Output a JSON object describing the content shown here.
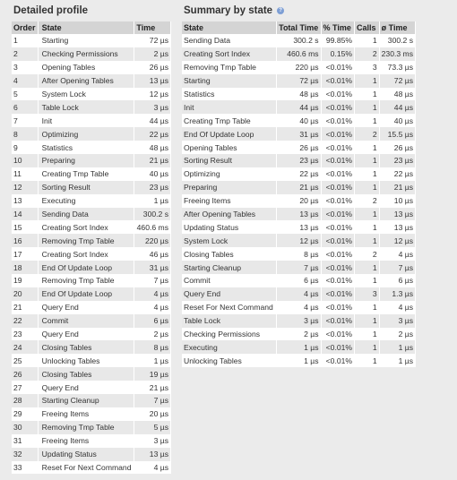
{
  "detailed": {
    "title": "Detailed profile",
    "headers": {
      "order": "Order",
      "state": "State",
      "time": "Time"
    },
    "rows": [
      {
        "order": "1",
        "state": "Starting",
        "time": "72 µs"
      },
      {
        "order": "2",
        "state": "Checking Permissions",
        "time": "2 µs"
      },
      {
        "order": "3",
        "state": "Opening Tables",
        "time": "26 µs"
      },
      {
        "order": "4",
        "state": "After Opening Tables",
        "time": "13 µs"
      },
      {
        "order": "5",
        "state": "System Lock",
        "time": "12 µs"
      },
      {
        "order": "6",
        "state": "Table Lock",
        "time": "3 µs"
      },
      {
        "order": "7",
        "state": "Init",
        "time": "44 µs"
      },
      {
        "order": "8",
        "state": "Optimizing",
        "time": "22 µs"
      },
      {
        "order": "9",
        "state": "Statistics",
        "time": "48 µs"
      },
      {
        "order": "10",
        "state": "Preparing",
        "time": "21 µs"
      },
      {
        "order": "11",
        "state": "Creating Tmp Table",
        "time": "40 µs"
      },
      {
        "order": "12",
        "state": "Sorting Result",
        "time": "23 µs"
      },
      {
        "order": "13",
        "state": "Executing",
        "time": "1 µs"
      },
      {
        "order": "14",
        "state": "Sending Data",
        "time": "300.2 s"
      },
      {
        "order": "15",
        "state": "Creating Sort Index",
        "time": "460.6 ms"
      },
      {
        "order": "16",
        "state": "Removing Tmp Table",
        "time": "220 µs"
      },
      {
        "order": "17",
        "state": "Creating Sort Index",
        "time": "46 µs"
      },
      {
        "order": "18",
        "state": "End Of Update Loop",
        "time": "31 µs"
      },
      {
        "order": "19",
        "state": "Removing Tmp Table",
        "time": "7 µs"
      },
      {
        "order": "20",
        "state": "End Of Update Loop",
        "time": "4 µs"
      },
      {
        "order": "21",
        "state": "Query End",
        "time": "4 µs"
      },
      {
        "order": "22",
        "state": "Commit",
        "time": "6 µs"
      },
      {
        "order": "23",
        "state": "Query End",
        "time": "2 µs"
      },
      {
        "order": "24",
        "state": "Closing Tables",
        "time": "8 µs"
      },
      {
        "order": "25",
        "state": "Unlocking Tables",
        "time": "1 µs"
      },
      {
        "order": "26",
        "state": "Closing Tables",
        "time": "19 µs"
      },
      {
        "order": "27",
        "state": "Query End",
        "time": "21 µs"
      },
      {
        "order": "28",
        "state": "Starting Cleanup",
        "time": "7 µs"
      },
      {
        "order": "29",
        "state": "Freeing Items",
        "time": "20 µs"
      },
      {
        "order": "30",
        "state": "Removing Tmp Table",
        "time": "5 µs"
      },
      {
        "order": "31",
        "state": "Freeing Items",
        "time": "3 µs"
      },
      {
        "order": "32",
        "state": "Updating Status",
        "time": "13 µs"
      },
      {
        "order": "33",
        "state": "Reset For Next Command",
        "time": "4 µs"
      }
    ]
  },
  "summary": {
    "title": "Summary by state",
    "help_icon": "help-icon",
    "headers": {
      "state": "State",
      "total": "Total Time",
      "pct": "% Time",
      "calls": "Calls",
      "avg": "ø Time"
    },
    "rows": [
      {
        "state": "Sending Data",
        "total": "300.2 s",
        "pct": "99.85%",
        "calls": "1",
        "avg": "300.2 s"
      },
      {
        "state": "Creating Sort Index",
        "total": "460.6 ms",
        "pct": "0.15%",
        "calls": "2",
        "avg": "230.3 ms"
      },
      {
        "state": "Removing Tmp Table",
        "total": "220 µs",
        "pct": "<0.01%",
        "calls": "3",
        "avg": "73.3 µs"
      },
      {
        "state": "Starting",
        "total": "72 µs",
        "pct": "<0.01%",
        "calls": "1",
        "avg": "72 µs"
      },
      {
        "state": "Statistics",
        "total": "48 µs",
        "pct": "<0.01%",
        "calls": "1",
        "avg": "48 µs"
      },
      {
        "state": "Init",
        "total": "44 µs",
        "pct": "<0.01%",
        "calls": "1",
        "avg": "44 µs"
      },
      {
        "state": "Creating Tmp Table",
        "total": "40 µs",
        "pct": "<0.01%",
        "calls": "1",
        "avg": "40 µs"
      },
      {
        "state": "End Of Update Loop",
        "total": "31 µs",
        "pct": "<0.01%",
        "calls": "2",
        "avg": "15.5 µs"
      },
      {
        "state": "Opening Tables",
        "total": "26 µs",
        "pct": "<0.01%",
        "calls": "1",
        "avg": "26 µs"
      },
      {
        "state": "Sorting Result",
        "total": "23 µs",
        "pct": "<0.01%",
        "calls": "1",
        "avg": "23 µs"
      },
      {
        "state": "Optimizing",
        "total": "22 µs",
        "pct": "<0.01%",
        "calls": "1",
        "avg": "22 µs"
      },
      {
        "state": "Preparing",
        "total": "21 µs",
        "pct": "<0.01%",
        "calls": "1",
        "avg": "21 µs"
      },
      {
        "state": "Freeing Items",
        "total": "20 µs",
        "pct": "<0.01%",
        "calls": "2",
        "avg": "10 µs"
      },
      {
        "state": "After Opening Tables",
        "total": "13 µs",
        "pct": "<0.01%",
        "calls": "1",
        "avg": "13 µs"
      },
      {
        "state": "Updating Status",
        "total": "13 µs",
        "pct": "<0.01%",
        "calls": "1",
        "avg": "13 µs"
      },
      {
        "state": "System Lock",
        "total": "12 µs",
        "pct": "<0.01%",
        "calls": "1",
        "avg": "12 µs"
      },
      {
        "state": "Closing Tables",
        "total": "8 µs",
        "pct": "<0.01%",
        "calls": "2",
        "avg": "4 µs"
      },
      {
        "state": "Starting Cleanup",
        "total": "7 µs",
        "pct": "<0.01%",
        "calls": "1",
        "avg": "7 µs"
      },
      {
        "state": "Commit",
        "total": "6 µs",
        "pct": "<0.01%",
        "calls": "1",
        "avg": "6 µs"
      },
      {
        "state": "Query End",
        "total": "4 µs",
        "pct": "<0.01%",
        "calls": "3",
        "avg": "1.3 µs"
      },
      {
        "state": "Reset For Next Command",
        "total": "4 µs",
        "pct": "<0.01%",
        "calls": "1",
        "avg": "4 µs"
      },
      {
        "state": "Table Lock",
        "total": "3 µs",
        "pct": "<0.01%",
        "calls": "1",
        "avg": "3 µs"
      },
      {
        "state": "Checking Permissions",
        "total": "2 µs",
        "pct": "<0.01%",
        "calls": "1",
        "avg": "2 µs"
      },
      {
        "state": "Executing",
        "total": "1 µs",
        "pct": "<0.01%",
        "calls": "1",
        "avg": "1 µs"
      },
      {
        "state": "Unlocking Tables",
        "total": "1 µs",
        "pct": "<0.01%",
        "calls": "1",
        "avg": "1 µs"
      }
    ]
  }
}
